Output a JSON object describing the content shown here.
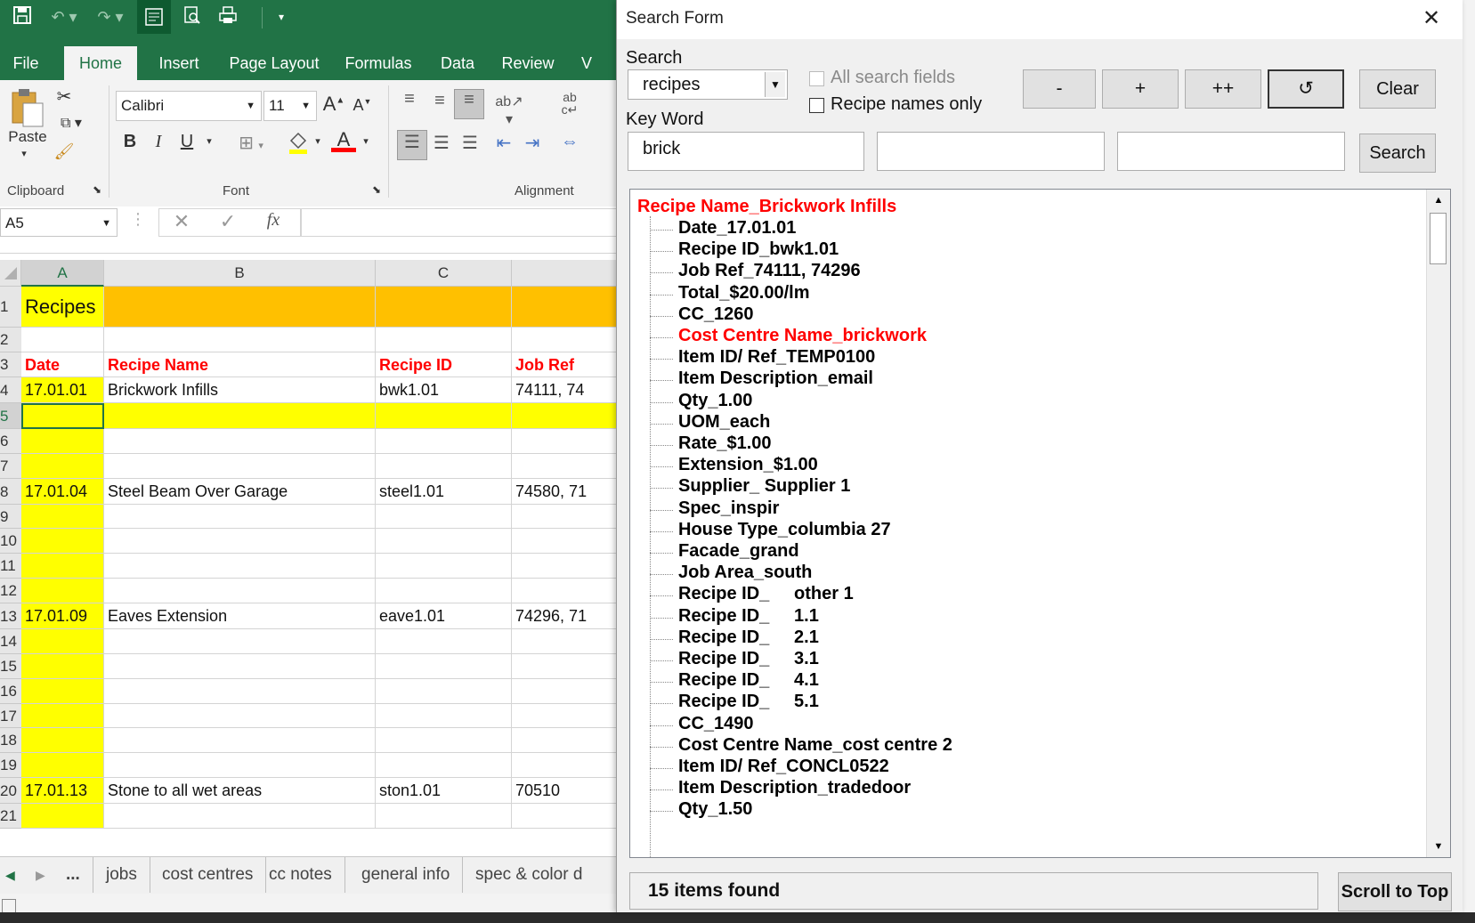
{
  "excel": {
    "ribbon_tabs": [
      "File",
      "Home",
      "Insert",
      "Page Layout",
      "Formulas",
      "Data",
      "Review",
      "V"
    ],
    "active_tab": "Home",
    "clipboard": {
      "paste_label": "Paste",
      "group_label": "Clipboard"
    },
    "font": {
      "name": "Calibri",
      "size": "11",
      "group_label": "Font",
      "bold": "B",
      "italic": "I",
      "underline": "U",
      "grow": "A",
      "shrink": "A",
      "font_color": "A"
    },
    "alignment": {
      "group_label": "Alignment"
    },
    "name_box": "A5",
    "fx": "fx",
    "columns": [
      "A",
      "B",
      "C"
    ],
    "col_d_partial": "",
    "rows": [
      {
        "num": "1",
        "a": "Recipes",
        "b": "",
        "c": "",
        "d": ""
      },
      {
        "num": "2",
        "a": "",
        "b": "",
        "c": "",
        "d": ""
      },
      {
        "num": "3",
        "a": "Date",
        "b": "Recipe Name",
        "c": "Recipe ID",
        "d": "Job Ref"
      },
      {
        "num": "4",
        "a": "17.01.01",
        "b": "Brickwork Infills",
        "c": "bwk1.01",
        "d": "74111, 74"
      },
      {
        "num": "5",
        "a": "",
        "b": "",
        "c": "",
        "d": ""
      },
      {
        "num": "6",
        "a": "",
        "b": "",
        "c": "",
        "d": ""
      },
      {
        "num": "7",
        "a": "",
        "b": "",
        "c": "",
        "d": ""
      },
      {
        "num": "8",
        "a": "17.01.04",
        "b": "Steel Beam Over Garage",
        "c": "steel1.01",
        "d": "74580, 71"
      },
      {
        "num": "9",
        "a": "",
        "b": "",
        "c": "",
        "d": ""
      },
      {
        "num": "10",
        "a": "",
        "b": "",
        "c": "",
        "d": ""
      },
      {
        "num": "11",
        "a": "",
        "b": "",
        "c": "",
        "d": ""
      },
      {
        "num": "12",
        "a": "",
        "b": "",
        "c": "",
        "d": ""
      },
      {
        "num": "13",
        "a": "17.01.09",
        "b": "Eaves Extension",
        "c": "eave1.01",
        "d": "74296, 71"
      },
      {
        "num": "14",
        "a": "",
        "b": "",
        "c": "",
        "d": ""
      },
      {
        "num": "15",
        "a": "",
        "b": "",
        "c": "",
        "d": ""
      },
      {
        "num": "16",
        "a": "",
        "b": "",
        "c": "",
        "d": ""
      },
      {
        "num": "17",
        "a": "",
        "b": "",
        "c": "",
        "d": ""
      },
      {
        "num": "18",
        "a": "",
        "b": "",
        "c": "",
        "d": ""
      },
      {
        "num": "19",
        "a": "",
        "b": "",
        "c": "",
        "d": ""
      },
      {
        "num": "20",
        "a": "17.01.13",
        "b": "Stone to all wet areas",
        "c": "ston1.01",
        "d": "70510"
      },
      {
        "num": "21",
        "a": "",
        "b": "",
        "c": "",
        "d": ""
      }
    ],
    "sheet_tabs": [
      "...",
      "jobs",
      "cost centres",
      "cc notes",
      "general info",
      "spec & color d"
    ]
  },
  "dialog": {
    "title": "Search Form",
    "search_label": "Search",
    "search_value": "recipes",
    "all_fields_label": "All search fields",
    "names_only_label": "Recipe names only",
    "keyword_label": "Key Word",
    "keyword1": "brick",
    "keyword2": "",
    "keyword3": "",
    "btn_minus": "-",
    "btn_plus": "+",
    "btn_plusplus": "++",
    "btn_clear": "Clear",
    "btn_search": "Search",
    "btn_scroll_top": "Scroll to Top",
    "status": "15 items found",
    "tree_root": "Recipe Name_Brickwork Infills",
    "tree_items": [
      {
        "text": "Date_17.01.01",
        "red": false
      },
      {
        "text": "Recipe ID_bwk1.01",
        "red": false
      },
      {
        "text": "Job Ref_74111, 74296",
        "red": false
      },
      {
        "text": "Total_$20.00/lm",
        "red": false
      },
      {
        "text": "CC_1260",
        "red": false
      },
      {
        "text": "Cost Centre Name_brickwork",
        "red": true
      },
      {
        "text": "Item ID/ Ref_TEMP0100",
        "red": false
      },
      {
        "text": "Item Description_email",
        "red": false
      },
      {
        "text": "Qty_1.00",
        "red": false
      },
      {
        "text": "UOM_each",
        "red": false
      },
      {
        "text": "Rate_$1.00",
        "red": false
      },
      {
        "text": "Extension_$1.00",
        "red": false
      },
      {
        "text": "Supplier_ Supplier 1",
        "red": false
      },
      {
        "text": "Spec_inspir",
        "red": false
      },
      {
        "text": "House Type_columbia 27",
        "red": false
      },
      {
        "text": "Facade_grand",
        "red": false
      },
      {
        "text": "Job Area_south",
        "red": false
      },
      {
        "text": "Recipe ID_     other 1",
        "red": false
      },
      {
        "text": "Recipe ID_     1.1",
        "red": false
      },
      {
        "text": "Recipe ID_     2.1",
        "red": false
      },
      {
        "text": "Recipe ID_     3.1",
        "red": false
      },
      {
        "text": "Recipe ID_     4.1",
        "red": false
      },
      {
        "text": "Recipe ID_     5.1",
        "red": false
      },
      {
        "text": "CC_1490",
        "red": false
      },
      {
        "text": "Cost Centre Name_cost centre 2",
        "red": false
      },
      {
        "text": "Item ID/ Ref_CONCL0522",
        "red": false
      },
      {
        "text": "Item Description_tradedoor",
        "red": false
      },
      {
        "text": "Qty_1.50",
        "red": false
      }
    ]
  }
}
